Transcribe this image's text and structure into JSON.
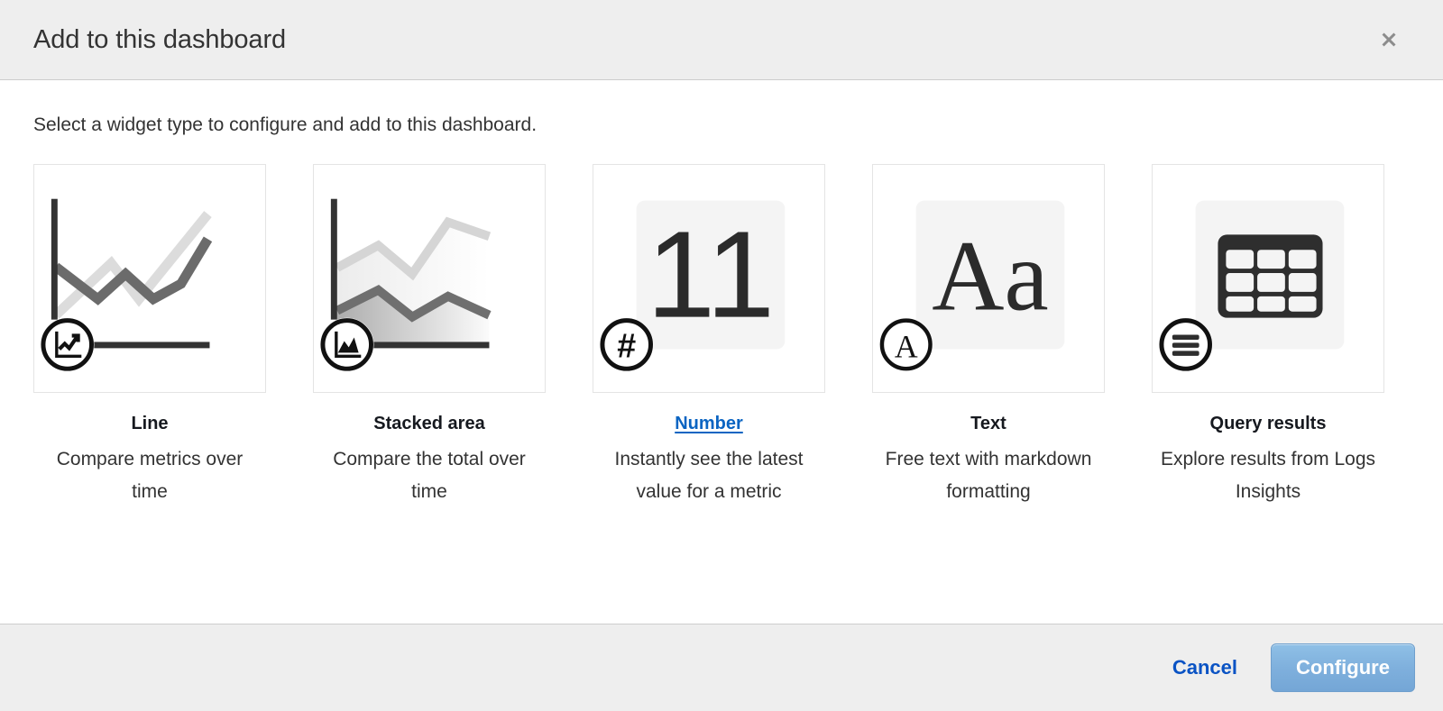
{
  "header": {
    "title": "Add to this dashboard",
    "close_icon": "close-icon"
  },
  "body": {
    "subtitle": "Select a widget type to configure and add to this dashboard."
  },
  "widgets": [
    {
      "id": "line",
      "label": "Line",
      "description": "Compare metrics over time",
      "badge_icon": "line-chart-badge-icon",
      "selected": false
    },
    {
      "id": "stacked-area",
      "label": "Stacked area",
      "description": "Compare the total over time",
      "badge_icon": "area-chart-badge-icon",
      "selected": false
    },
    {
      "id": "number",
      "label": "Number",
      "description": "Instantly see the latest value for a metric",
      "preview_value": "11",
      "badge_icon": "hash-badge-icon",
      "selected": true
    },
    {
      "id": "text",
      "label": "Text",
      "description": "Free text with markdown formatting",
      "preview_value": "Aa",
      "badge_icon": "letter-a-badge-icon",
      "selected": false
    },
    {
      "id": "query-results",
      "label": "Query results",
      "description": "Explore results from Logs Insights",
      "badge_icon": "list-badge-icon",
      "selected": false
    }
  ],
  "footer": {
    "cancel_label": "Cancel",
    "configure_label": "Configure"
  },
  "colors": {
    "link": "#0a64c2",
    "cancel_link": "#0a53c4",
    "primary_button": "#7fb0dd",
    "chrome_background": "#eeeeee",
    "body_background": "#ffffff",
    "card_border": "#e4e4e4",
    "series_dark": "#666666",
    "series_light": "#d8d8d8",
    "axis": "#333333"
  }
}
